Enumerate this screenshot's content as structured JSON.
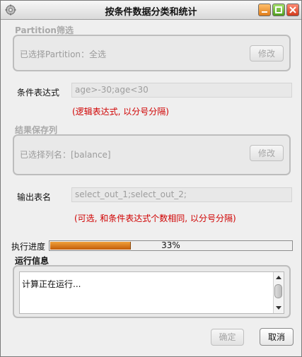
{
  "window": {
    "title": "按条件数据分类和统计"
  },
  "partition": {
    "section_title": "Partition筛选",
    "selected_text": "已选择Partition：全选",
    "modify_label": "修改"
  },
  "condition": {
    "label": "条件表达式",
    "value": "age>-30;age<30",
    "hint": "(逻辑表达式, 以分号分隔)"
  },
  "result_columns": {
    "section_title": "结果保存列",
    "selected_text": "已选择列名：[balance]",
    "modify_label": "修改"
  },
  "output_table": {
    "label": "输出表名",
    "value": "select_out_1;select_out_2;",
    "hint": "(可选, 和条件表达式个数相同, 以分号分隔)"
  },
  "progress": {
    "label": "执行进度",
    "percent_text": "33%",
    "value": 0.33,
    "fill_color": "#e07d1a"
  },
  "run_info": {
    "section_title": "运行信息",
    "log_text": "计算正在运行..."
  },
  "footer": {
    "ok_label": "确定",
    "cancel_label": "取消"
  },
  "icons": {
    "app": "gear-icon",
    "minimize": "minimize-icon",
    "maximize": "maximize-icon",
    "close": "close-icon"
  }
}
